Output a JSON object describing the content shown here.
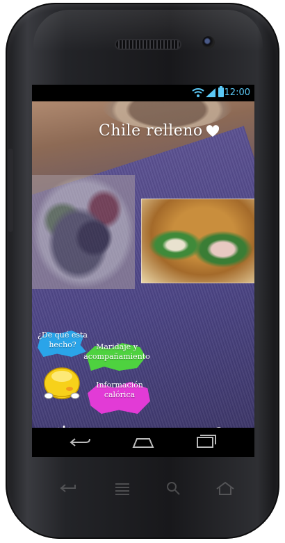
{
  "status_bar": {
    "time": "12:00",
    "battery_icon": "battery-icon",
    "wifi_icon": "wifi-icon",
    "signal_icon": "signal-icon"
  },
  "dish": {
    "title": "Chile relleno",
    "favorite_icon": "heart-icon"
  },
  "menu": {
    "made_of": "¿De qué esta hecho?",
    "pairing": "Maridaje y acompañamiento",
    "calories": "Información calórica",
    "colors": {
      "made_of": "#2aa4e9",
      "pairing": "#4ed23f",
      "calories": "#e23bd6"
    }
  },
  "toolbar": {
    "settings_icon": "gear-icon",
    "camera_icon": "camera-switch-icon",
    "help_label": "?"
  },
  "nav": {
    "back_icon": "back-icon",
    "home_icon": "home-icon",
    "recent_icon": "recent-apps-icon"
  },
  "colors": {
    "accent": "#5bc8f5"
  }
}
